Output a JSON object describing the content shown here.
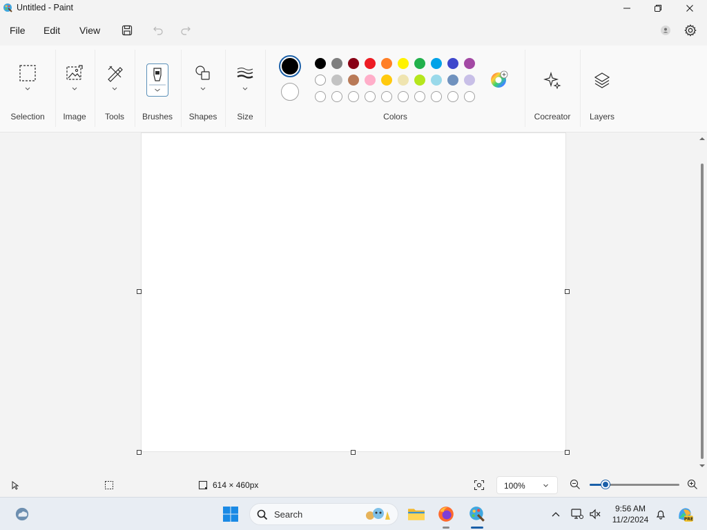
{
  "window": {
    "title": "Untitled - Paint"
  },
  "menu": {
    "file": "File",
    "edit": "Edit",
    "view": "View"
  },
  "ribbon": {
    "groups": {
      "selection": "Selection",
      "image": "Image",
      "tools": "Tools",
      "brushes": "Brushes",
      "shapes": "Shapes",
      "size": "Size",
      "colors": "Colors",
      "cocreator": "Cocreator",
      "layers": "Layers"
    },
    "primary_color": "#000000",
    "secondary_color": "#ffffff",
    "palette_row1": [
      "#000000",
      "#7f7f7f",
      "#880015",
      "#ed1c24",
      "#ff7f27",
      "#fff200",
      "#22b14c",
      "#00a2e8",
      "#3f48cc",
      "#a349a4"
    ],
    "palette_row2": [
      "#ffffff",
      "#c3c3c3",
      "#b97a57",
      "#ffaec9",
      "#ffc90e",
      "#efe4b0",
      "#b5e61d",
      "#99d9ea",
      "#7092be",
      "#c8bfe7"
    ]
  },
  "status": {
    "canvas_size": "614 × 460px",
    "zoom": "100%",
    "zoom_fraction": 0.18
  },
  "taskbar": {
    "search_label": "Search",
    "time": "9:56 AM",
    "date": "11/2/2024"
  }
}
